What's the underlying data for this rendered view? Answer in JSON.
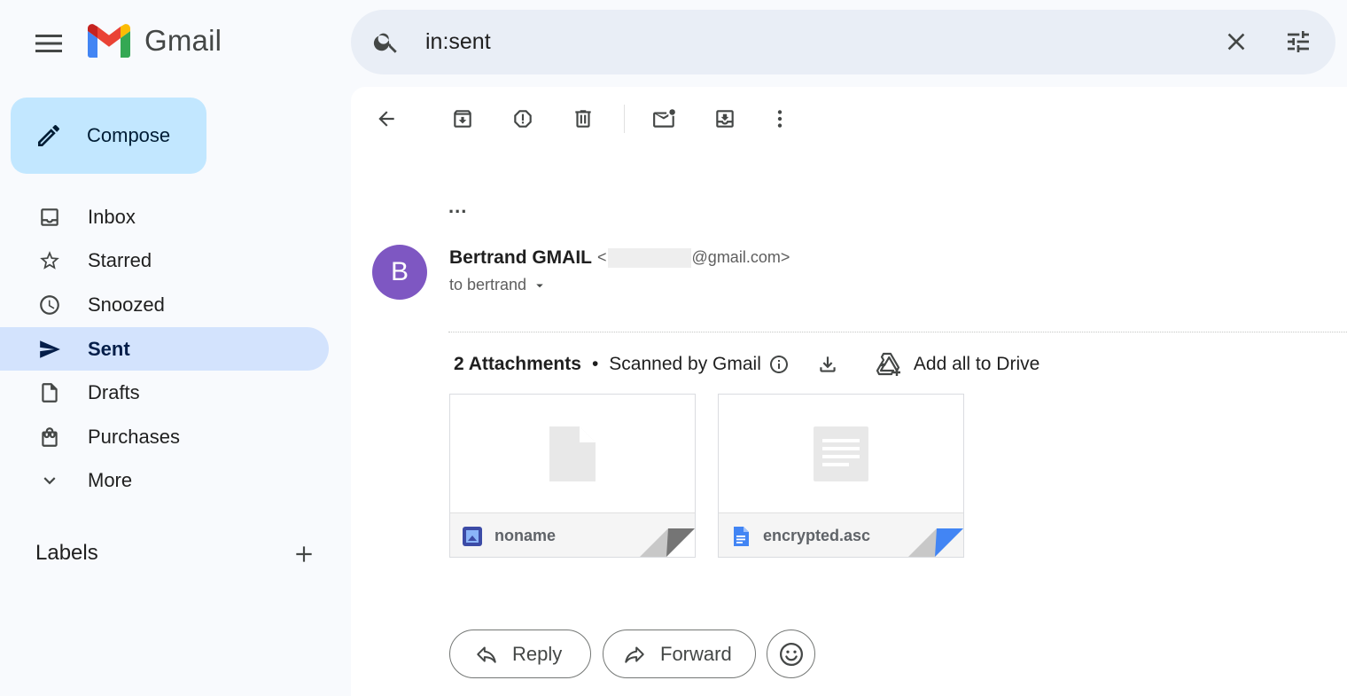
{
  "app": {
    "name": "Gmail"
  },
  "search": {
    "query": "in:sent"
  },
  "sidebar": {
    "compose_label": "Compose",
    "items": [
      {
        "label": "Inbox",
        "icon": "inbox-icon"
      },
      {
        "label": "Starred",
        "icon": "star-icon"
      },
      {
        "label": "Snoozed",
        "icon": "clock-icon"
      },
      {
        "label": "Sent",
        "icon": "send-icon",
        "active": true
      },
      {
        "label": "Drafts",
        "icon": "draft-icon"
      },
      {
        "label": "Purchases",
        "icon": "shopping-bag-icon"
      },
      {
        "label": "More",
        "icon": "chevron-down-icon"
      }
    ],
    "labels_heading": "Labels"
  },
  "message": {
    "collapsed_indicator": "...",
    "avatar_letter": "B",
    "avatar_color": "#7e57c2",
    "sender_name": "Bertrand GMAIL",
    "sender_addr_open": "<",
    "sender_addr_domain": "@gmail.com>",
    "to_line": "to bertrand"
  },
  "attachments": {
    "count_label": "2 Attachments",
    "separator": "•",
    "scanned_label": "Scanned by Gmail",
    "add_drive_label": "Add all to Drive",
    "files": [
      {
        "name": "noname",
        "type": "generic"
      },
      {
        "name": "encrypted.asc",
        "type": "document"
      }
    ]
  },
  "actions": {
    "reply": "Reply",
    "forward": "Forward"
  },
  "colors": {
    "accent": "#c2e7ff",
    "active_nav": "#d3e3fd",
    "search_bg": "#e9eef6",
    "doc_blue": "#4285f4"
  }
}
